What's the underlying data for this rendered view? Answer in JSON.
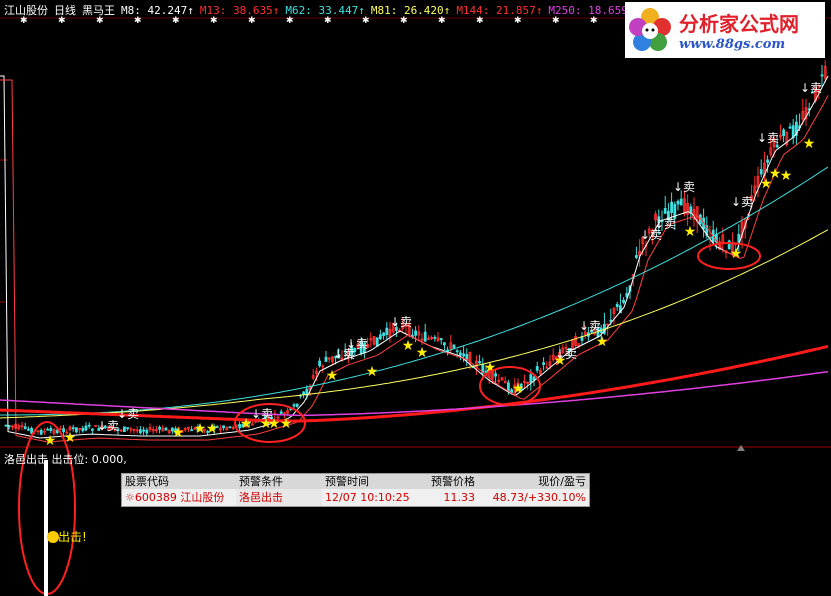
{
  "header": {
    "stock": "江山股份",
    "period": "日线",
    "indicator": "黑马王",
    "ma": [
      {
        "label": "M8: 42.247↑",
        "color": "#ffffff"
      },
      {
        "label": "M13: 38.635↑",
        "color": "#ff3030"
      },
      {
        "label": "M62: 33.447↑",
        "color": "#40e0e0"
      },
      {
        "label": "M81: 26.420↑",
        "color": "#ffff60"
      },
      {
        "label": "M144: 21.857↑",
        "color": "#ff3030"
      },
      {
        "label": "M250: 18.659↑",
        "color": "#e040e0"
      }
    ]
  },
  "logo": {
    "name": "分析家公式网",
    "url": "www.88gs.com"
  },
  "chart_labels": {
    "sell": "卖",
    "sell_arrow": "↓卖",
    "star": "★",
    "hit": "出击!"
  },
  "sub_panel": {
    "title": "洛邑出击",
    "value": "出击位: 0.000,"
  },
  "table": {
    "headers": [
      "股票代码",
      "预警条件",
      "预警时间",
      "预警价格",
      "现价/盈亏"
    ],
    "row": {
      "code": "600389",
      "name": "江山股份",
      "condition": "洛邑出击",
      "time": "12/07 10:10:25",
      "price": "11.33",
      "now": "48.73/+330.10%"
    }
  },
  "colors": {
    "up": "#ff3030",
    "down": "#40e0e0",
    "m8": "#ffffff",
    "m62": "#40e0e0",
    "m81": "#ffff60",
    "m144": "#ff1a1a",
    "m250": "#e040e0",
    "circle": "#ff2020",
    "star": "#ffee00"
  }
}
